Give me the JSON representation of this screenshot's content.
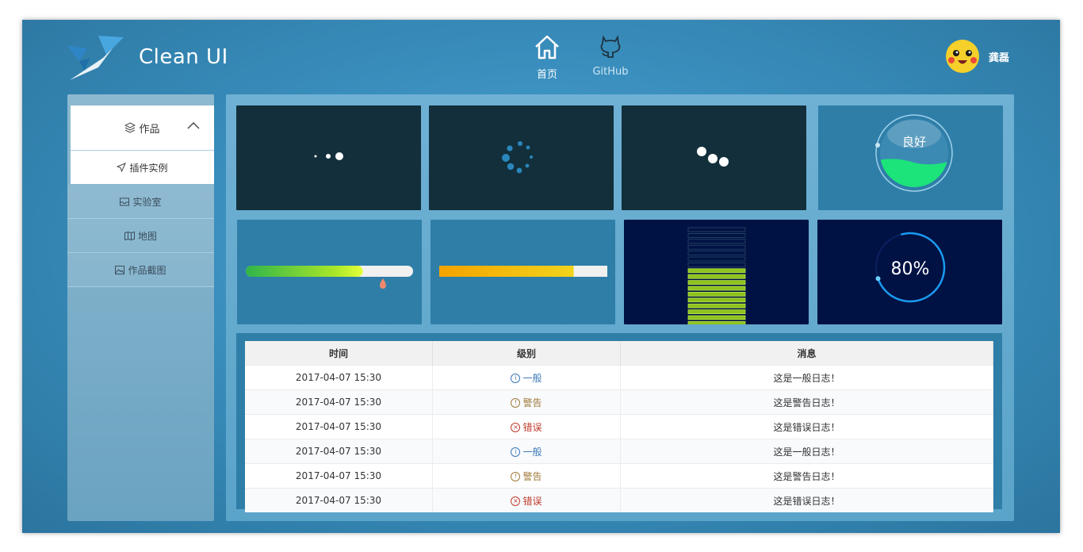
{
  "app": {
    "title": "Clean UI"
  },
  "nav": [
    {
      "label": "首页",
      "icon": "home-icon"
    },
    {
      "label": "GitHub",
      "icon": "github-icon"
    }
  ],
  "user": {
    "name": "龚磊",
    "avatar": "pikachu-avatar"
  },
  "sidebar": {
    "group": {
      "label": "作品",
      "icon": "layers-icon",
      "expanded": true
    },
    "active_item": {
      "label": "插件实例",
      "icon": "send-icon"
    },
    "items": [
      {
        "label": "实验室",
        "icon": "inbox-icon"
      },
      {
        "label": "地图",
        "icon": "map-icon"
      },
      {
        "label": "作品截图",
        "icon": "image-icon"
      }
    ]
  },
  "widgets": {
    "water_ball": {
      "label": "良好",
      "accent": "#1de47a"
    },
    "progress_green": {
      "level_percent": 70,
      "accent": "#3dbb3d"
    },
    "progress_orange": {
      "level_percent": 80,
      "accent": "#f5a300"
    },
    "battery_bars": {
      "total": 17,
      "filled": 10,
      "accent": "#8ec21f"
    },
    "ring": {
      "label": "80%",
      "value": 80,
      "accent": "#1a9af0"
    }
  },
  "log_table": {
    "headers": [
      "时间",
      "级别",
      "消息"
    ],
    "rows": [
      {
        "time": "2017-04-07 15:30",
        "level": "一般",
        "level_type": "info",
        "message": "这是一般日志！"
      },
      {
        "time": "2017-04-07 15:30",
        "level": "警告",
        "level_type": "warn",
        "message": "这是警告日志！"
      },
      {
        "time": "2017-04-07 15:30",
        "level": "错误",
        "level_type": "error",
        "message": "这是错误日志！"
      },
      {
        "time": "2017-04-07 15:30",
        "level": "一般",
        "level_type": "info",
        "message": "这是一般日志！"
      },
      {
        "time": "2017-04-07 15:30",
        "level": "警告",
        "level_type": "warn",
        "message": "这是警告日志！"
      },
      {
        "time": "2017-04-07 15:30",
        "level": "错误",
        "level_type": "error",
        "message": "这是错误日志！"
      }
    ]
  },
  "colors": {
    "brand": "#3a8fbe",
    "dark_card": "#122f3b",
    "navy_card": "#001244"
  }
}
